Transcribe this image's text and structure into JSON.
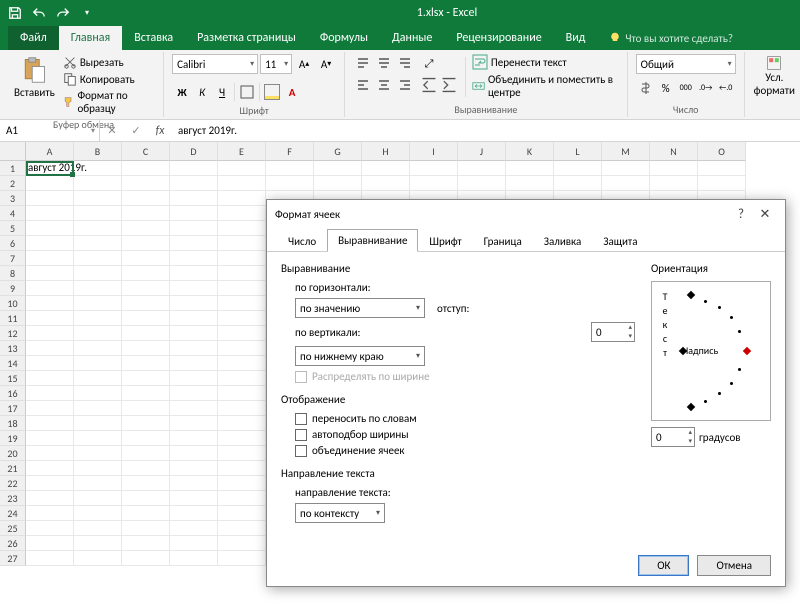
{
  "app_title": "1.xlsx - Excel",
  "tabs": {
    "file": "Файл",
    "home": "Главная",
    "insert": "Вставка",
    "layout": "Разметка страницы",
    "formulas": "Формулы",
    "data": "Данные",
    "review": "Рецензирование",
    "view": "Вид",
    "tellme": "Что вы хотите сделать?"
  },
  "ribbon": {
    "clipboard": {
      "paste": "Вставить",
      "cut": "Вырезать",
      "copy": "Копировать",
      "painter": "Формат по образцу",
      "group": "Буфер обмена"
    },
    "font": {
      "name": "Calibri",
      "size": "11",
      "group": "Шрифт",
      "bold": "Ж",
      "italic": "К",
      "underline": "Ч"
    },
    "align": {
      "wrap": "Перенести текст",
      "merge": "Объединить и поместить в центре",
      "group": "Выравнивание"
    },
    "number": {
      "format": "Общий",
      "group": "Число"
    },
    "styles": {
      "cond": "Усл.",
      "fmt": "формати"
    }
  },
  "namebox": "A1",
  "formula": "август 2019г.",
  "cell_a1": "август 201",
  "cell_a1_suffix": "9г.",
  "cols": [
    "A",
    "B",
    "C",
    "D",
    "E",
    "F",
    "G",
    "H",
    "I",
    "J",
    "K",
    "L",
    "M",
    "N",
    "O"
  ],
  "rows": [
    "1",
    "2",
    "3",
    "4",
    "5",
    "6",
    "7",
    "8",
    "9",
    "10",
    "11",
    "12",
    "13",
    "14",
    "15",
    "16",
    "17",
    "18",
    "19",
    "20",
    "21",
    "22",
    "23",
    "24",
    "25",
    "26",
    "27"
  ],
  "dialog": {
    "title": "Формат ячеек",
    "tabs": {
      "number": "Число",
      "align": "Выравнивание",
      "font": "Шрифт",
      "border": "Граница",
      "fill": "Заливка",
      "protect": "Защита"
    },
    "section_align": "Выравнивание",
    "label_horiz": "по горизонтали:",
    "val_horiz": "по значению",
    "label_indent": "отступ:",
    "val_indent": "0",
    "label_vert": "по вертикали:",
    "val_vert": "по нижнему краю",
    "distribute": "Распределять по ширине",
    "section_display": "Отображение",
    "wrap": "переносить по словам",
    "autofit": "автоподбор ширины",
    "merge": "объединение ячеек",
    "section_direction": "Направление текста",
    "label_direction": "направление текста:",
    "val_direction": "по контексту",
    "orientation": "Ориентация",
    "orient_vtext": "Т\nе\nк\nс\nт",
    "orient_label": "Надпись",
    "degrees": "0",
    "degrees_label": "градусов",
    "ok": "ОК",
    "cancel": "Отмена"
  }
}
